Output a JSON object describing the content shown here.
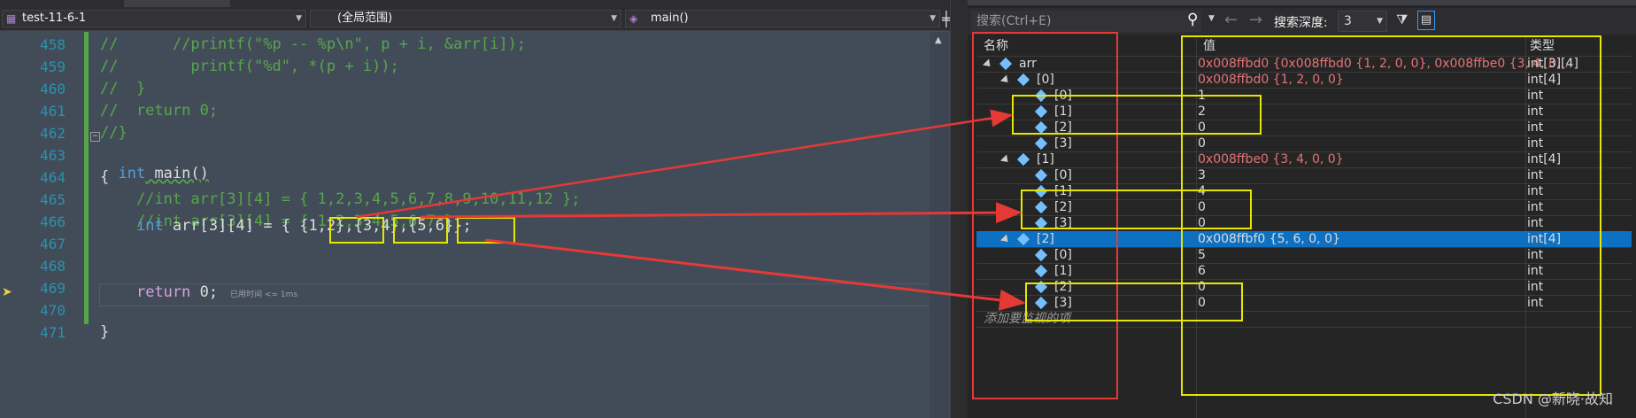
{
  "editor": {
    "navbar": {
      "project": "test-11-6-1",
      "scope": "(全局范围)",
      "function": "main()"
    },
    "lines": [
      {
        "num": "458",
        "text": "//      //printf(\"%p -- %p\\n\", p + i, &arr[i]);"
      },
      {
        "num": "459",
        "text": "//        printf(\"%d\", *(p + i));"
      },
      {
        "num": "460",
        "text": "//  }"
      },
      {
        "num": "461",
        "text": "//  return 0;"
      },
      {
        "num": "462",
        "text": "//}"
      },
      {
        "num": "463",
        "text": ""
      },
      {
        "num": "464",
        "text": "{"
      },
      {
        "num": "465",
        "text": "    //int arr[3][4] = { 1,2,3,4,5,6,7,8,9,10,11,12 };"
      },
      {
        "num": "466",
        "text": "    //int arr[3][4] = { 1,2,3,4,5,6,7 };"
      },
      {
        "num": "467",
        "text": ""
      },
      {
        "num": "468",
        "text": ""
      },
      {
        "num": "469",
        "text": ""
      },
      {
        "num": "470",
        "text": ""
      },
      {
        "num": "471",
        "text": "}"
      }
    ],
    "line463": {
      "kw": "int",
      "rest": " main()"
    },
    "line467": {
      "kw": "int",
      "a": " arr[3][4] = { ",
      "g1": "{1,2}",
      "c1": ",",
      "g2": "{3,4}",
      "c2": ",",
      "g3": "{5,6}",
      "end": "};"
    },
    "line470": {
      "kw": "return",
      "rest": " 0;",
      "hint": "已用时间 <= 1ms"
    }
  },
  "watch": {
    "search_placeholder": "搜索(Ctrl+E)",
    "depth_label": "搜索深度:",
    "depth_value": "3",
    "col_name": "名称",
    "col_value": "值",
    "col_type": "类型",
    "rows": [
      {
        "name": "arr",
        "value": "0x008ffbd0 {0x008ffbd0 {1, 2, 0, 0}, 0x008ffbe0 {3, 4, 0...",
        "type": "int[3][4]"
      },
      {
        "name": "[0]",
        "value": "0x008ffbd0 {1, 2, 0, 0}",
        "type": "int[4]"
      },
      {
        "name": "[0]",
        "value": "1",
        "type": "int"
      },
      {
        "name": "[1]",
        "value": "2",
        "type": "int"
      },
      {
        "name": "[2]",
        "value": "0",
        "type": "int"
      },
      {
        "name": "[3]",
        "value": "0",
        "type": "int"
      },
      {
        "name": "[1]",
        "value": "0x008ffbe0 {3, 4, 0, 0}",
        "type": "int[4]"
      },
      {
        "name": "[0]",
        "value": "3",
        "type": "int"
      },
      {
        "name": "[1]",
        "value": "4",
        "type": "int"
      },
      {
        "name": "[2]",
        "value": "0",
        "type": "int"
      },
      {
        "name": "[3]",
        "value": "0",
        "type": "int"
      },
      {
        "name": "[2]",
        "value": "0x008ffbf0 {5, 6, 0, 0}",
        "type": "int[4]"
      },
      {
        "name": "[0]",
        "value": "5",
        "type": "int"
      },
      {
        "name": "[1]",
        "value": "6",
        "type": "int"
      },
      {
        "name": "[2]",
        "value": "0",
        "type": "int"
      },
      {
        "name": "[3]",
        "value": "0",
        "type": "int"
      }
    ],
    "add_item": "添加要监视的项"
  },
  "watermark": "CSDN @新晓·故知",
  "colors": {
    "annotation_red": "#e53935",
    "annotation_yellow": "#e6e600",
    "selected_row": "#0e70c0"
  }
}
